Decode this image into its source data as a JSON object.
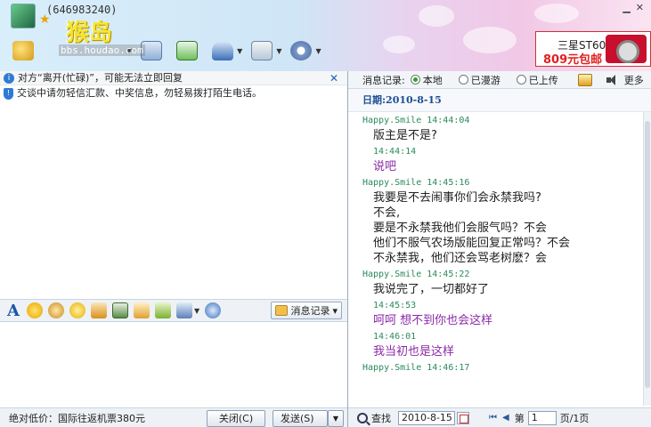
{
  "header": {
    "qq_number": "(646983240)",
    "logo_text": "猴岛",
    "logo_url": "bbs.houdao.com"
  },
  "ad": {
    "line1": "三星ST60",
    "line2": "809元包邮"
  },
  "notices": {
    "status": "对方“离开(忙碌)”，可能无法立即回复",
    "close_glyph": "✕",
    "warning": "交谈中请勿轻信汇款、中奖信息，勿轻易拨打陌生电话。"
  },
  "input_toolbar": {
    "font_glyph": "A",
    "message_record_label": "消息记录",
    "dropdown_glyph": "▾"
  },
  "bottom": {
    "ad_text": "绝对低价：国际往返机票380元",
    "close_label": "关闭(C)",
    "send_label": "发送(S)",
    "send_drop": "▼"
  },
  "record_bar": {
    "label": "消息记录:",
    "local": "本地",
    "roaming": "已漫游",
    "uploaded": "已上传",
    "more": "更多"
  },
  "history": {
    "date_label": "日期:2010-8-15",
    "messages": [
      {
        "head": "Happy.Smile 14:44:04",
        "body": "版主是不是?",
        "me": false
      },
      {
        "head": "14:44:14",
        "body": "说吧",
        "me": true
      },
      {
        "head": "Happy.Smile 14:45:16",
        "body": "我要是不去闹事你们会永禁我吗?\n不会,\n要是不永禁我他们会服气吗？不会\n他们不服气农场版能回复正常吗？不会\n不永禁我，他们还会骂老树麽？会",
        "me": false
      },
      {
        "head": "Happy.Smile 14:45:22",
        "body": "我说完了，一切都好了",
        "me": false
      },
      {
        "head": "14:45:53",
        "body": "呵呵 想不到你也会这样",
        "me": true
      },
      {
        "head": "14:46:01",
        "body": "我当初也是这样",
        "me": true
      },
      {
        "head": "Happy.Smile 14:46:17",
        "body": "",
        "me": false
      }
    ]
  },
  "find_bar": {
    "find_label": "查找",
    "date_value": "2010-8-15",
    "nav_glyphs": "⏮◀",
    "page_prefix": "第",
    "page_value": "1",
    "page_suffix": "页/1页"
  },
  "colors": {
    "header_accent": "#1c4e94",
    "peer_head": "#2a8a5a",
    "self_text": "#8a2aa8"
  }
}
